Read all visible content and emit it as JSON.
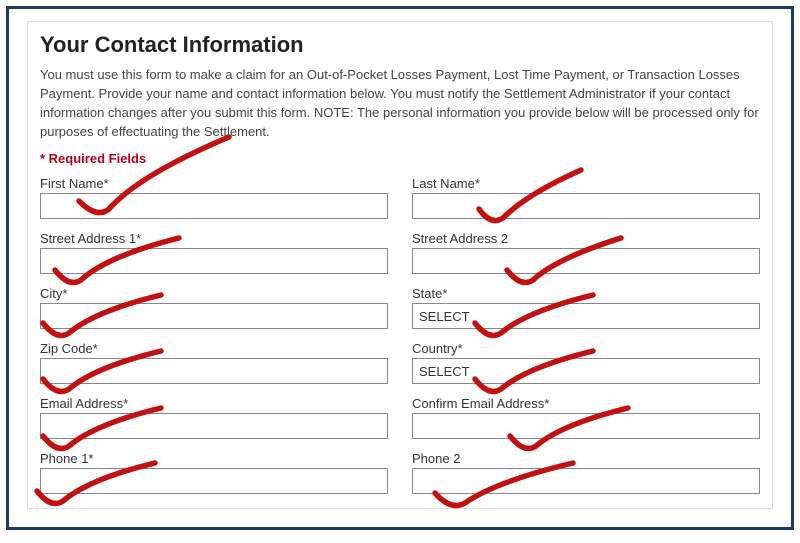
{
  "form": {
    "title": "Your Contact Information",
    "intro": "You must use this form to make a claim for an Out-of-Pocket Losses Payment, Lost Time Payment, or Transaction Losses Payment. Provide your name and contact information below. You must notify the Settlement Administrator if your contact information changes after you submit this form. NOTE: The personal information you provide below will be processed only for purposes of effectuating the Settlement.",
    "required_note": "* Required Fields",
    "fields": {
      "first_name": {
        "label": "First Name*",
        "value": ""
      },
      "last_name": {
        "label": "Last Name*",
        "value": ""
      },
      "street1": {
        "label": "Street Address 1*",
        "value": ""
      },
      "street2": {
        "label": "Street Address 2",
        "value": ""
      },
      "city": {
        "label": "City*",
        "value": ""
      },
      "state": {
        "label": "State*",
        "value": "SELECT"
      },
      "zip": {
        "label": "Zip Code*",
        "value": ""
      },
      "country": {
        "label": "Country*",
        "value": "SELECT"
      },
      "email": {
        "label": "Email Address*",
        "value": ""
      },
      "confirm_email": {
        "label": "Confirm Email Address*",
        "value": ""
      },
      "phone1": {
        "label": "Phone 1*",
        "value": ""
      },
      "phone2": {
        "label": "Phone 2",
        "value": ""
      }
    }
  }
}
